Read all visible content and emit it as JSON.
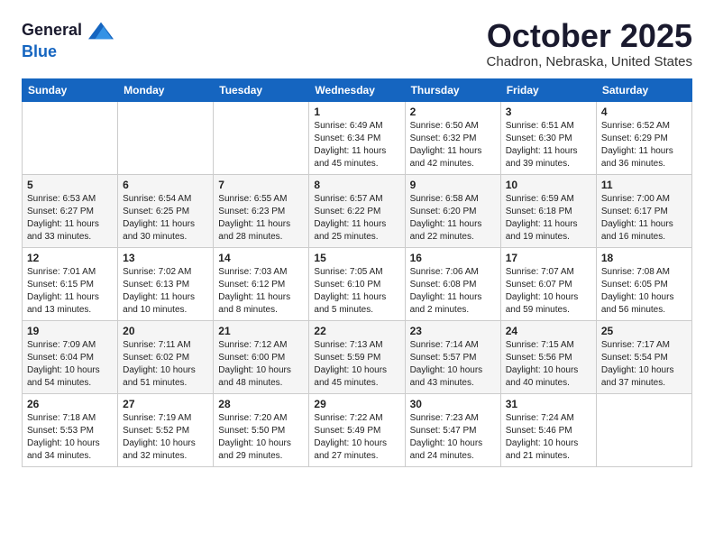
{
  "header": {
    "logo_line1": "General",
    "logo_line2": "Blue",
    "month_title": "October 2025",
    "subtitle": "Chadron, Nebraska, United States"
  },
  "days_of_week": [
    "Sunday",
    "Monday",
    "Tuesday",
    "Wednesday",
    "Thursday",
    "Friday",
    "Saturday"
  ],
  "weeks": [
    [
      {
        "day": "",
        "info": ""
      },
      {
        "day": "",
        "info": ""
      },
      {
        "day": "",
        "info": ""
      },
      {
        "day": "1",
        "info": "Sunrise: 6:49 AM\nSunset: 6:34 PM\nDaylight: 11 hours\nand 45 minutes."
      },
      {
        "day": "2",
        "info": "Sunrise: 6:50 AM\nSunset: 6:32 PM\nDaylight: 11 hours\nand 42 minutes."
      },
      {
        "day": "3",
        "info": "Sunrise: 6:51 AM\nSunset: 6:30 PM\nDaylight: 11 hours\nand 39 minutes."
      },
      {
        "day": "4",
        "info": "Sunrise: 6:52 AM\nSunset: 6:29 PM\nDaylight: 11 hours\nand 36 minutes."
      }
    ],
    [
      {
        "day": "5",
        "info": "Sunrise: 6:53 AM\nSunset: 6:27 PM\nDaylight: 11 hours\nand 33 minutes."
      },
      {
        "day": "6",
        "info": "Sunrise: 6:54 AM\nSunset: 6:25 PM\nDaylight: 11 hours\nand 30 minutes."
      },
      {
        "day": "7",
        "info": "Sunrise: 6:55 AM\nSunset: 6:23 PM\nDaylight: 11 hours\nand 28 minutes."
      },
      {
        "day": "8",
        "info": "Sunrise: 6:57 AM\nSunset: 6:22 PM\nDaylight: 11 hours\nand 25 minutes."
      },
      {
        "day": "9",
        "info": "Sunrise: 6:58 AM\nSunset: 6:20 PM\nDaylight: 11 hours\nand 22 minutes."
      },
      {
        "day": "10",
        "info": "Sunrise: 6:59 AM\nSunset: 6:18 PM\nDaylight: 11 hours\nand 19 minutes."
      },
      {
        "day": "11",
        "info": "Sunrise: 7:00 AM\nSunset: 6:17 PM\nDaylight: 11 hours\nand 16 minutes."
      }
    ],
    [
      {
        "day": "12",
        "info": "Sunrise: 7:01 AM\nSunset: 6:15 PM\nDaylight: 11 hours\nand 13 minutes."
      },
      {
        "day": "13",
        "info": "Sunrise: 7:02 AM\nSunset: 6:13 PM\nDaylight: 11 hours\nand 10 minutes."
      },
      {
        "day": "14",
        "info": "Sunrise: 7:03 AM\nSunset: 6:12 PM\nDaylight: 11 hours\nand 8 minutes."
      },
      {
        "day": "15",
        "info": "Sunrise: 7:05 AM\nSunset: 6:10 PM\nDaylight: 11 hours\nand 5 minutes."
      },
      {
        "day": "16",
        "info": "Sunrise: 7:06 AM\nSunset: 6:08 PM\nDaylight: 11 hours\nand 2 minutes."
      },
      {
        "day": "17",
        "info": "Sunrise: 7:07 AM\nSunset: 6:07 PM\nDaylight: 10 hours\nand 59 minutes."
      },
      {
        "day": "18",
        "info": "Sunrise: 7:08 AM\nSunset: 6:05 PM\nDaylight: 10 hours\nand 56 minutes."
      }
    ],
    [
      {
        "day": "19",
        "info": "Sunrise: 7:09 AM\nSunset: 6:04 PM\nDaylight: 10 hours\nand 54 minutes."
      },
      {
        "day": "20",
        "info": "Sunrise: 7:11 AM\nSunset: 6:02 PM\nDaylight: 10 hours\nand 51 minutes."
      },
      {
        "day": "21",
        "info": "Sunrise: 7:12 AM\nSunset: 6:00 PM\nDaylight: 10 hours\nand 48 minutes."
      },
      {
        "day": "22",
        "info": "Sunrise: 7:13 AM\nSunset: 5:59 PM\nDaylight: 10 hours\nand 45 minutes."
      },
      {
        "day": "23",
        "info": "Sunrise: 7:14 AM\nSunset: 5:57 PM\nDaylight: 10 hours\nand 43 minutes."
      },
      {
        "day": "24",
        "info": "Sunrise: 7:15 AM\nSunset: 5:56 PM\nDaylight: 10 hours\nand 40 minutes."
      },
      {
        "day": "25",
        "info": "Sunrise: 7:17 AM\nSunset: 5:54 PM\nDaylight: 10 hours\nand 37 minutes."
      }
    ],
    [
      {
        "day": "26",
        "info": "Sunrise: 7:18 AM\nSunset: 5:53 PM\nDaylight: 10 hours\nand 34 minutes."
      },
      {
        "day": "27",
        "info": "Sunrise: 7:19 AM\nSunset: 5:52 PM\nDaylight: 10 hours\nand 32 minutes."
      },
      {
        "day": "28",
        "info": "Sunrise: 7:20 AM\nSunset: 5:50 PM\nDaylight: 10 hours\nand 29 minutes."
      },
      {
        "day": "29",
        "info": "Sunrise: 7:22 AM\nSunset: 5:49 PM\nDaylight: 10 hours\nand 27 minutes."
      },
      {
        "day": "30",
        "info": "Sunrise: 7:23 AM\nSunset: 5:47 PM\nDaylight: 10 hours\nand 24 minutes."
      },
      {
        "day": "31",
        "info": "Sunrise: 7:24 AM\nSunset: 5:46 PM\nDaylight: 10 hours\nand 21 minutes."
      },
      {
        "day": "",
        "info": ""
      }
    ]
  ]
}
